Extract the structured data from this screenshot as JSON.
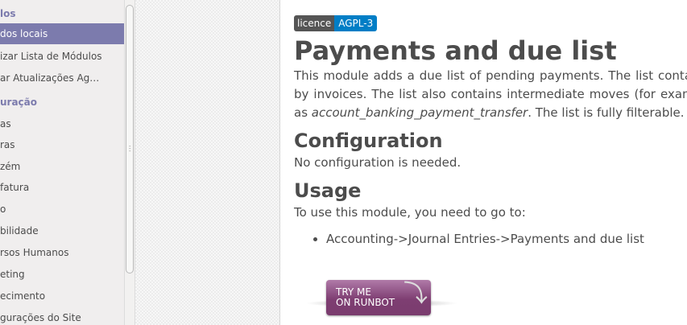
{
  "sidebar": {
    "items": [
      {
        "label": "los",
        "kind": "header"
      },
      {
        "label": "dos locais",
        "kind": "active"
      },
      {
        "label": "izar Lista de Módulos",
        "kind": "item"
      },
      {
        "label": "ar Atualizações Ag…",
        "kind": "item"
      },
      {
        "label": "uração",
        "kind": "header"
      },
      {
        "label": "as",
        "kind": "item"
      },
      {
        "label": "ras",
        "kind": "item"
      },
      {
        "label": "zém",
        "kind": "item"
      },
      {
        "label": "fatura",
        "kind": "item"
      },
      {
        "label": "o",
        "kind": "item"
      },
      {
        "label": "bilidade",
        "kind": "item"
      },
      {
        "label": "rsos Humanos",
        "kind": "item"
      },
      {
        "label": "eting",
        "kind": "item"
      },
      {
        "label": "ecimento",
        "kind": "item"
      },
      {
        "label": "gurações do Site",
        "kind": "item"
      }
    ]
  },
  "module": {
    "badge_key": "licence",
    "badge_value": "AGPL-3",
    "title": "Payments and due list",
    "description_lead": "This module adds a due list of pending payments. The list contains every expected payment, generated by invoices. The list also contains intermediate moves (for example, generated by payment orders such as",
    "description_module": "account_banking_payment_transfer",
    "description_tail": ". The list is fully filterable.",
    "configuration_heading": "Configuration",
    "configuration_text": "No configuration is needed.",
    "usage_heading": "Usage",
    "usage_text": "To use this module, you need to go to:",
    "usage_steps": [
      "Accounting->Journal Entries->Payments and due list"
    ],
    "runbot_line1": "TRY ME",
    "runbot_line2": "ON RUNBOT"
  },
  "colors": {
    "sidebar_accent": "#7c7bad",
    "badge_key_bg": "#555555",
    "badge_value_bg": "#007ec6",
    "runbot_button": "#7e3e72"
  }
}
